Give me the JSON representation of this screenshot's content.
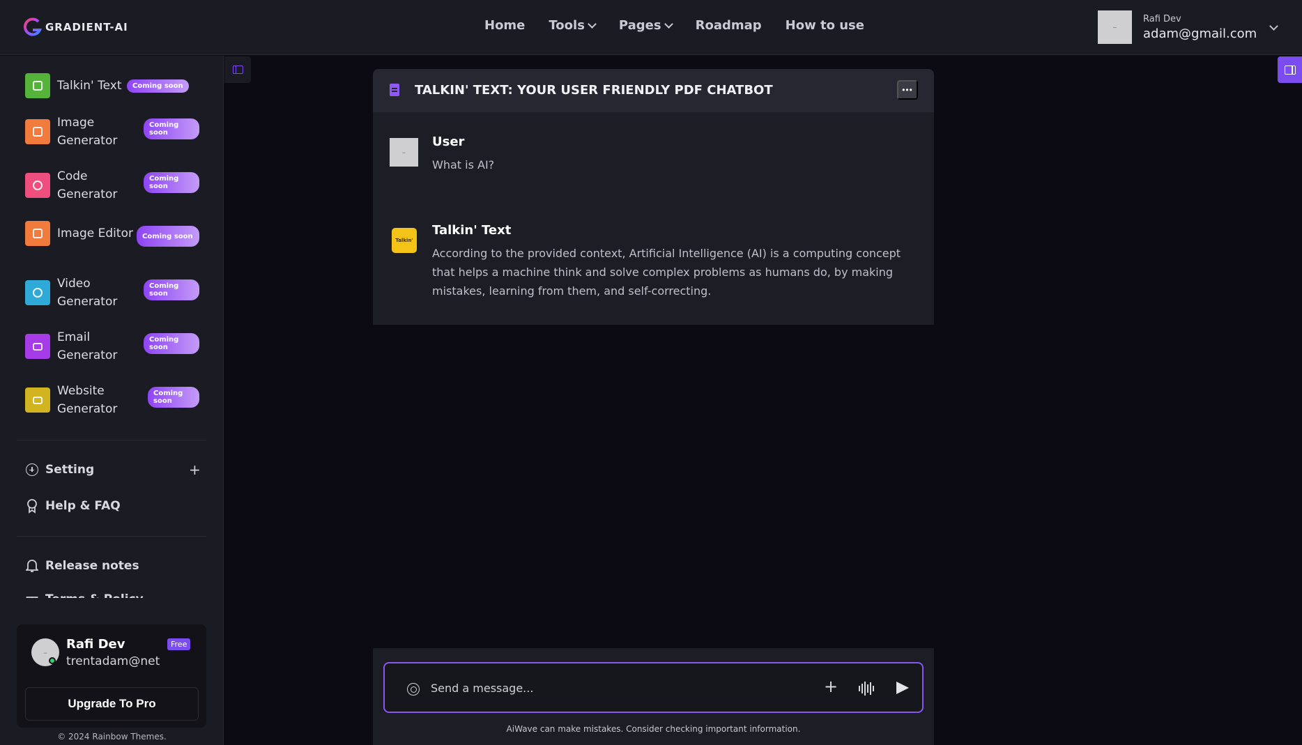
{
  "brand": {
    "name": "GRADIENT-AI"
  },
  "nav": [
    {
      "label": "Home",
      "dropdown": false
    },
    {
      "label": "Tools",
      "dropdown": true
    },
    {
      "label": "Pages",
      "dropdown": true
    },
    {
      "label": "Roadmap",
      "dropdown": false
    },
    {
      "label": "How to use",
      "dropdown": false
    }
  ],
  "profile": {
    "name": "Rafi Dev",
    "email": "adam@gmail.com"
  },
  "sidebar": {
    "tools": [
      {
        "label": "Talkin' Text",
        "badge": "Coming soon",
        "color": "#55b33a"
      },
      {
        "label": "Image Generator",
        "badge": "Coming soon",
        "color": "#f07b3c"
      },
      {
        "label": "Code Generator",
        "badge": "Coming soon",
        "color": "#ef4f7f"
      },
      {
        "label": "Image Editor",
        "badge": "Coming soon",
        "color": "#f07b3c"
      },
      {
        "label": "Video Generator",
        "badge": "Coming soon",
        "color": "#2fa9d8"
      },
      {
        "label": "Email Generator",
        "badge": "Coming soon",
        "color": "#a63be8"
      },
      {
        "label": "Website Generator",
        "badge": "Coming soon",
        "color": "#d2b320"
      }
    ],
    "links": [
      {
        "label": "Setting",
        "icon": "plus-circle-icon"
      },
      {
        "label": "Help & FAQ",
        "icon": "award-icon"
      },
      {
        "label": "Release notes",
        "icon": "bell-icon"
      },
      {
        "label": "Terms & Policy",
        "icon": "gift-icon"
      }
    ],
    "user_card": {
      "name": "Rafi Dev",
      "email": "trentadam@net",
      "plan": "Free",
      "upgrade_label": "Upgrade To Pro"
    },
    "copyright": "© 2024  Rainbow Themes."
  },
  "chat": {
    "title": "TALKIN' TEXT: YOUR USER FRIENDLY PDF CHATBOT",
    "messages": [
      {
        "sender": "User",
        "text": "What is AI?"
      },
      {
        "sender": "Talkin' Text",
        "avatar_label": "Talkin'",
        "text": "According to the provided context, Artificial Intelligence (AI) is a computing concept that helps a machine think and solve complex problems as humans do, by making mistakes, learning from them, and self-correcting."
      }
    ]
  },
  "composer": {
    "placeholder": "Send a message...",
    "disclaimer": "AiWave can make mistakes. Consider checking important information."
  },
  "colors": {
    "accent": "#7b4cf0",
    "background": "#0c0b13",
    "panel": "#1b1c23"
  }
}
